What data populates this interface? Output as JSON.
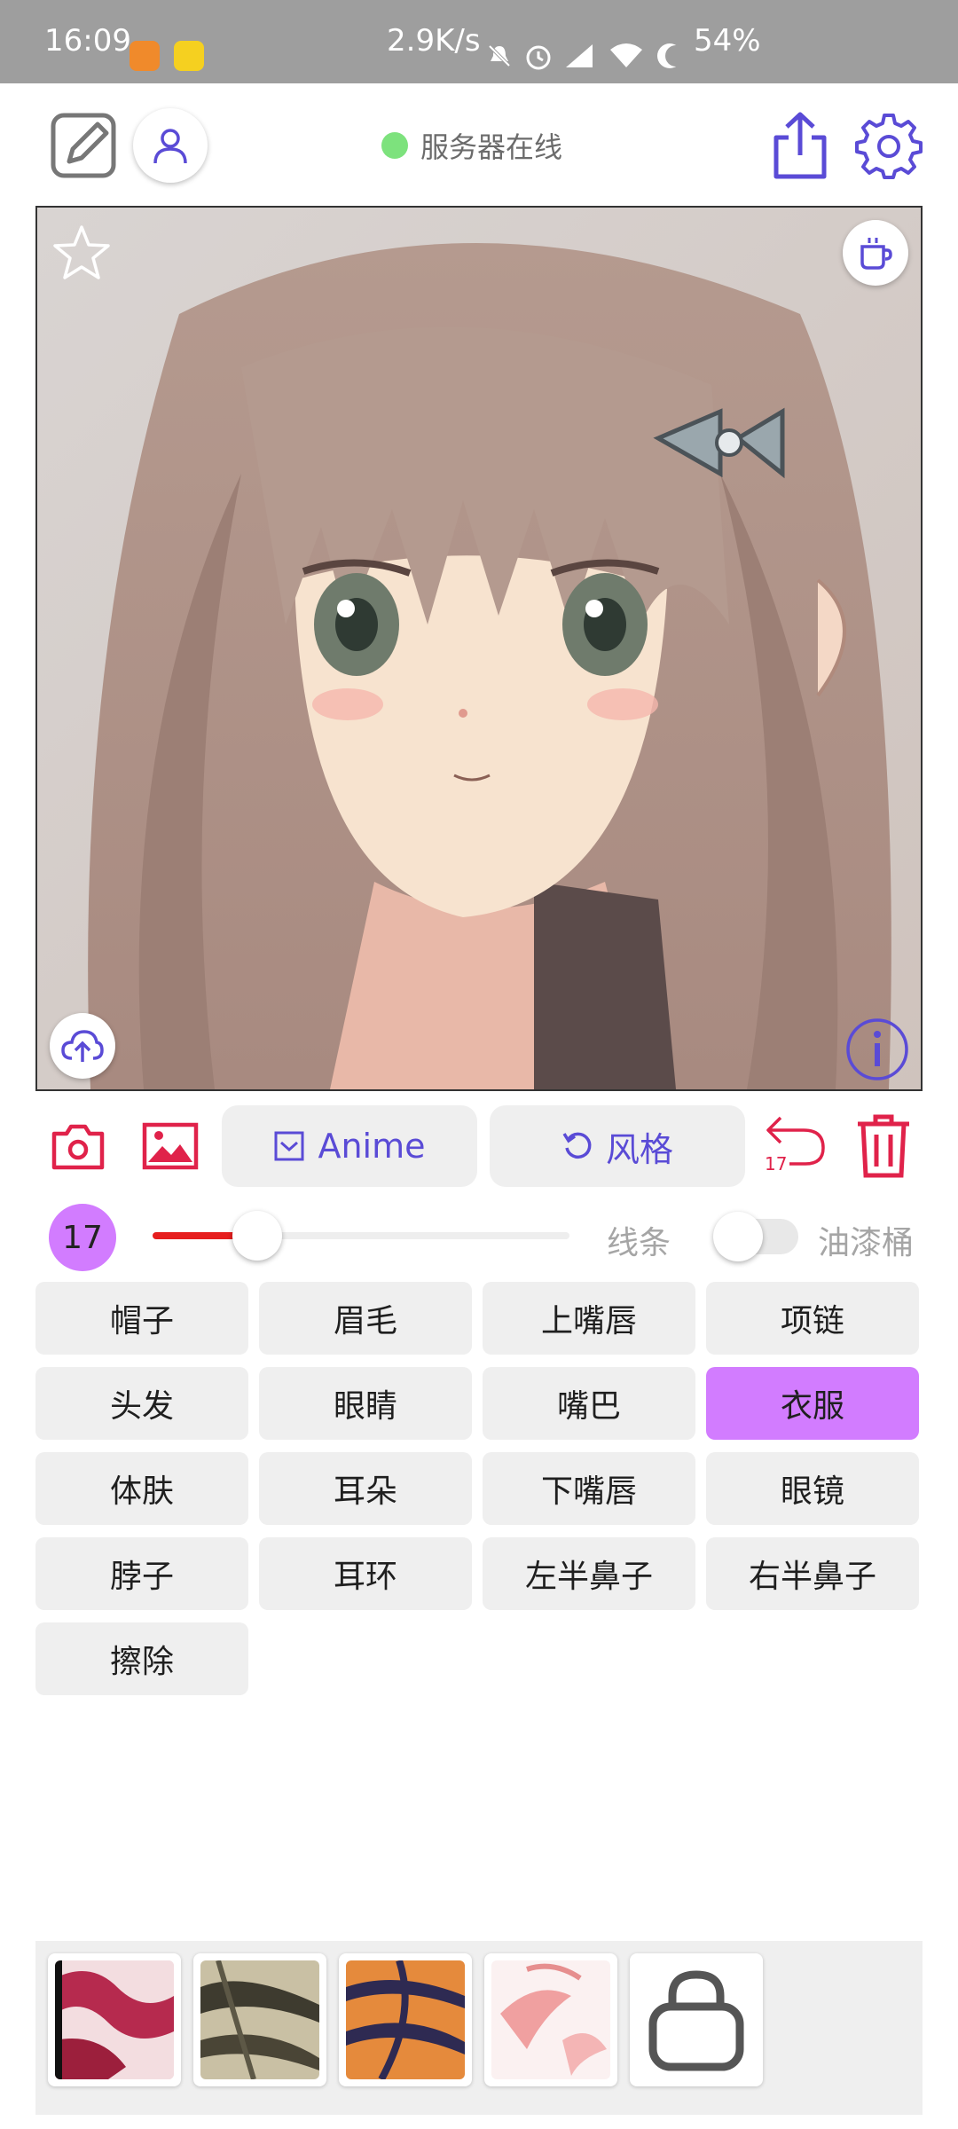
{
  "status_bar": {
    "time": "16:09",
    "net_speed": "2.9K/s",
    "battery": "54%"
  },
  "header": {
    "server_status": "服务器在线"
  },
  "tools": {
    "anime_label": "Anime",
    "style_label": "风格",
    "undo_count": "17"
  },
  "controls": {
    "brush_size": "17",
    "slider_value": 0.25,
    "line_label": "线条",
    "bucket_label": "油漆桶"
  },
  "parts": [
    {
      "label": "帽子",
      "selected": false
    },
    {
      "label": "眉毛",
      "selected": false
    },
    {
      "label": "上嘴唇",
      "selected": false
    },
    {
      "label": "项链",
      "selected": false
    },
    {
      "label": "头发",
      "selected": false
    },
    {
      "label": "眼睛",
      "selected": false
    },
    {
      "label": "嘴巴",
      "selected": false
    },
    {
      "label": "衣服",
      "selected": true
    },
    {
      "label": "体肤",
      "selected": false
    },
    {
      "label": "耳朵",
      "selected": false
    },
    {
      "label": "下嘴唇",
      "selected": false
    },
    {
      "label": "眼镜",
      "selected": false
    },
    {
      "label": "脖子",
      "selected": false
    },
    {
      "label": "耳环",
      "selected": false
    },
    {
      "label": "左半鼻子",
      "selected": false
    },
    {
      "label": "右半鼻子",
      "selected": false
    },
    {
      "label": "擦除",
      "selected": false
    }
  ],
  "colors": {
    "accent_purple": "#5a4bd6",
    "accent_red": "#e0224a",
    "selected_part": "#d27cff",
    "online_dot": "#7de27d",
    "slider_fill": "#e61e1e"
  }
}
